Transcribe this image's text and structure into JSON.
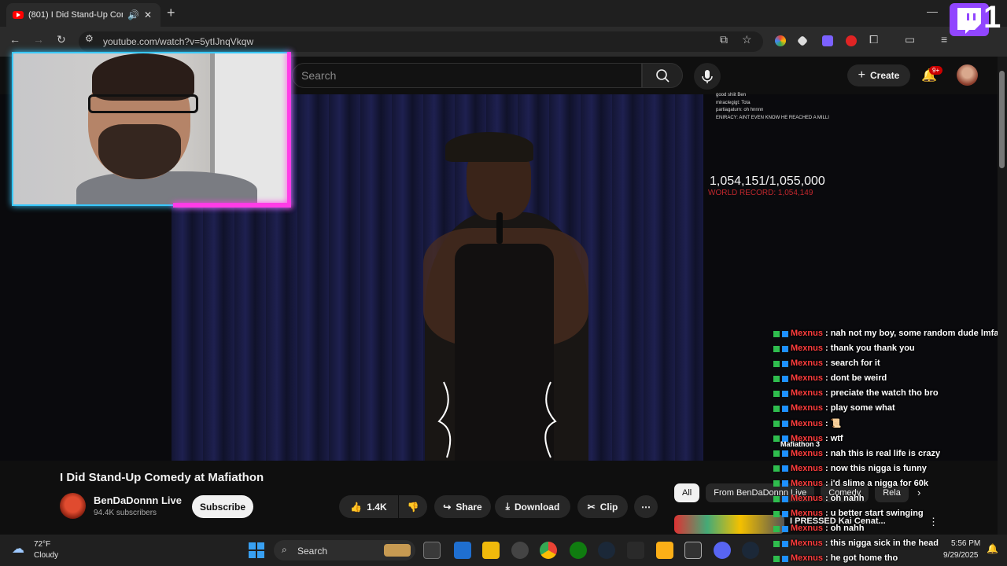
{
  "browser": {
    "tab_title": "(801) I Did Stand-Up Comed",
    "speaker_glyph": "🔊",
    "close_glyph": "✕",
    "newtab_glyph": "+",
    "minimize_glyph": "—",
    "url": "youtube.com/watch?v=5ytIJnqVkqw"
  },
  "youtube": {
    "search_placeholder": "Search",
    "create_label": "Create",
    "notif_count": "9+",
    "video_title": "I Did Stand-Up Comedy at Mafiathon",
    "channel_name": "BenDaDonnn Live",
    "channel_subs": "94.4K subscribers",
    "subscribe_label": "Subscribe",
    "like_count": "1.4K",
    "share_label": "Share",
    "download_label": "Download",
    "clip_label": "Clip",
    "chips": [
      "All",
      "From BenDaDonnn Live",
      "Comedy",
      "Rela"
    ],
    "rec_title": "I PRESSED Kai Cenat..."
  },
  "overlay": {
    "counter": "1,054,151/1,055,000",
    "record": "WORLD RECORD: 1,054,149",
    "mafia_label": "Mafiathon 3",
    "stream_chat": [
      {
        "n": "",
        "m": "good shiit Ben"
      },
      {
        "n": "",
        "m": "miraclegigt: Tota"
      },
      {
        "n": "",
        "m": "partiagaturn: oh hnnnn"
      },
      {
        "n": "",
        "m": "ENIRACY: AINT EVEN KNOW HE REACHED A MILLI"
      }
    ]
  },
  "chat": [
    {
      "user": "Mexnus",
      "msg": ": nah not my boy, some random dude lmfao"
    },
    {
      "user": "Mexnus",
      "msg": ": thank you thank you"
    },
    {
      "user": "Mexnus",
      "msg": ": search for it"
    },
    {
      "user": "Mexnus",
      "msg": ": dont be weird"
    },
    {
      "user": "Mexnus",
      "msg": ": preciate the watch tho bro"
    },
    {
      "user": "Mexnus",
      "msg": ": play some what"
    },
    {
      "user": "Mexnus",
      "msg": ": 📜"
    },
    {
      "user": "Mexnus",
      "msg": ": wtf"
    },
    {
      "user": "Mexnus",
      "msg": ": nah this is real life is crazy"
    },
    {
      "user": "Mexnus",
      "msg": ": now this nigga is funny"
    },
    {
      "user": "Mexnus",
      "msg": ": i'd slime a nigga for 60k"
    },
    {
      "user": "Mexnus",
      "msg": ": oh nahh"
    },
    {
      "user": "Mexnus",
      "msg": ": u better start swinging"
    },
    {
      "user": "Mexnus",
      "msg": ": oh nahh"
    }
  ],
  "tray_chat": [
    {
      "user": "Mexnus",
      "msg": ": this nigga sick in the head"
    },
    {
      "user": "Mexnus",
      "msg": ": he got home tho"
    }
  ],
  "taskbar": {
    "temp": "72°F",
    "weather": "Cloudy",
    "search_label": "Search",
    "time": "5:56 PM",
    "date": "9/29/2025"
  },
  "twitch_counter": "1"
}
